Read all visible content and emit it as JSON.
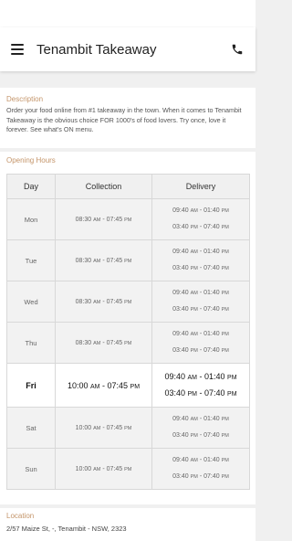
{
  "header": {
    "title": "Tenambit Takeaway"
  },
  "description": {
    "label": "Description",
    "text": "Order your food online from #1 takeaway in the town. When it comes to Tenambit Takeaway is the obvious choice FOR 1000's of food lovers. Try once, love it forever. See what's ON menu."
  },
  "hours": {
    "label": "Opening Hours",
    "columns": [
      "Day",
      "Collection",
      "Delivery"
    ],
    "rows": [
      {
        "day": "Mon",
        "col_start": "08:30",
        "col_start_ap": "AM",
        "col_end": "07:45",
        "col_end_ap": "PM",
        "d1_start": "09:40",
        "d1_start_ap": "AM",
        "d1_end": "01:40",
        "d1_end_ap": "PM",
        "d2_start": "03:40",
        "d2_start_ap": "PM",
        "d2_end": "07:40",
        "d2_end_ap": "PM"
      },
      {
        "day": "Tue",
        "col_start": "08:30",
        "col_start_ap": "AM",
        "col_end": "07:45",
        "col_end_ap": "PM",
        "d1_start": "09:40",
        "d1_start_ap": "AM",
        "d1_end": "01:40",
        "d1_end_ap": "PM",
        "d2_start": "03:40",
        "d2_start_ap": "PM",
        "d2_end": "07:40",
        "d2_end_ap": "PM"
      },
      {
        "day": "Wed",
        "col_start": "08:30",
        "col_start_ap": "AM",
        "col_end": "07:45",
        "col_end_ap": "PM",
        "d1_start": "09:40",
        "d1_start_ap": "AM",
        "d1_end": "01:40",
        "d1_end_ap": "PM",
        "d2_start": "03:40",
        "d2_start_ap": "PM",
        "d2_end": "07:40",
        "d2_end_ap": "PM"
      },
      {
        "day": "Thu",
        "col_start": "08:30",
        "col_start_ap": "AM",
        "col_end": "07:45",
        "col_end_ap": "PM",
        "d1_start": "09:40",
        "d1_start_ap": "AM",
        "d1_end": "01:40",
        "d1_end_ap": "PM",
        "d2_start": "03:40",
        "d2_start_ap": "PM",
        "d2_end": "07:40",
        "d2_end_ap": "PM"
      },
      {
        "day": "Fri",
        "col_start": "10:00",
        "col_start_ap": "AM",
        "col_end": "07:45",
        "col_end_ap": "PM",
        "d1_start": "09:40",
        "d1_start_ap": "AM",
        "d1_end": "01:40",
        "d1_end_ap": "PM",
        "d2_start": "03:40",
        "d2_start_ap": "PM",
        "d2_end": "07:40",
        "d2_end_ap": "PM"
      },
      {
        "day": "Sat",
        "col_start": "10:00",
        "col_start_ap": "AM",
        "col_end": "07:45",
        "col_end_ap": "PM",
        "d1_start": "09:40",
        "d1_start_ap": "AM",
        "d1_end": "01:40",
        "d1_end_ap": "PM",
        "d2_start": "03:40",
        "d2_start_ap": "PM",
        "d2_end": "07:40",
        "d2_end_ap": "PM"
      },
      {
        "day": "Sun",
        "col_start": "10:00",
        "col_start_ap": "AM",
        "col_end": "07:45",
        "col_end_ap": "PM",
        "d1_start": "09:40",
        "d1_start_ap": "AM",
        "d1_end": "01:40",
        "d1_end_ap": "PM",
        "d2_start": "03:40",
        "d2_start_ap": "PM",
        "d2_end": "07:40",
        "d2_end_ap": "PM"
      }
    ]
  },
  "location": {
    "label": "Location",
    "address": "2/57 Maize St, -, Tenambit - NSW, 2323"
  },
  "icons": {
    "menu": "hamburger-menu-icon",
    "call": "phone-icon"
  },
  "colors": {
    "section_label": "#c4956a",
    "background": "#f0f0f0"
  }
}
